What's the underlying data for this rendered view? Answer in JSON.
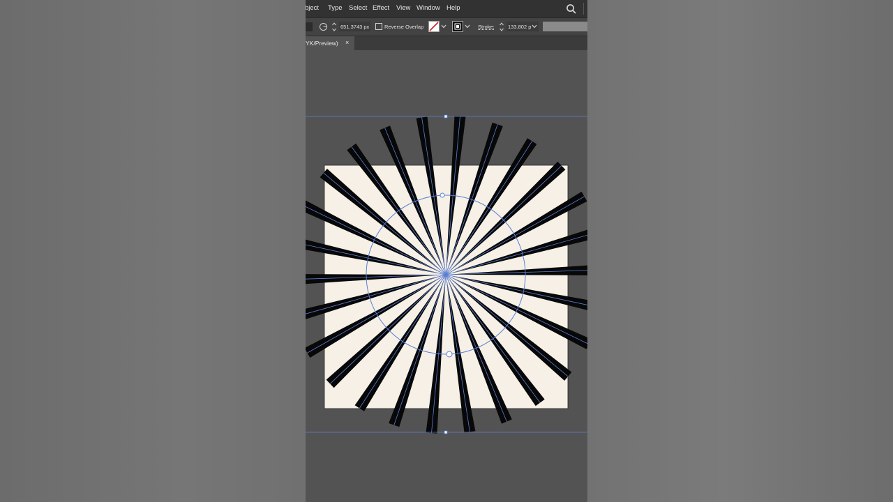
{
  "menubar": {
    "items": [
      "bject",
      "Type",
      "Select",
      "Effect",
      "View",
      "Window",
      "Help"
    ]
  },
  "control_bar": {
    "radius_value": "651.3743 px",
    "reverse_overlap_label": "Reverse Overlap",
    "stroke_label": "Stroke:",
    "stroke_value": "133.802 p"
  },
  "document_tab": {
    "title": "YK/Preview)",
    "close_glyph": "×"
  },
  "artwork": {
    "artboard_color": "#f6f0e6",
    "ray_color": "#080808",
    "guide_color": "#5b7fd6",
    "ray_count": 26
  },
  "icons": [
    "search-icon",
    "radius-icon",
    "stepper-icon",
    "checkbox-icon",
    "fill-none-swatch",
    "stroke-swatch",
    "chevron-down-icon",
    "close-icon"
  ]
}
